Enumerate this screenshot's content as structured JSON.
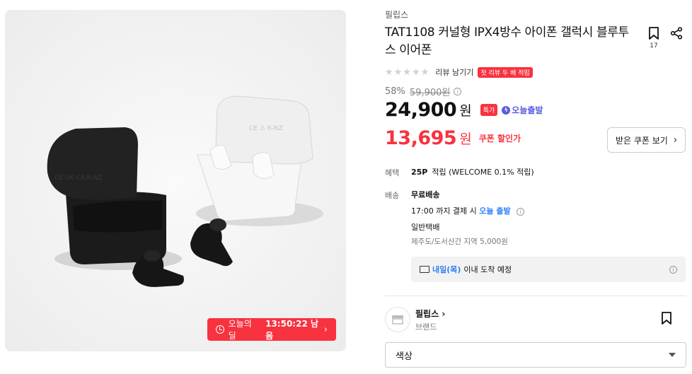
{
  "gallery": {
    "deal_label": "오늘의딜",
    "deal_time": "13:50:22 남음",
    "deal_arrow": "›"
  },
  "product": {
    "brand": "필립스",
    "title": "TAT1108 커널형 IPX4방수 아이폰 갤럭시 블루투스 이어폰",
    "bookmark_count": "17",
    "stars": "★★★★★",
    "review_link": "리뷰 남기기",
    "first_review_badge": "첫 리뷰 두 배 적립",
    "discount_rate": "58%",
    "original_price": "59,900원",
    "price": "24,900",
    "currency": "원",
    "special_badge": "특가",
    "today_delivery": "오늘출발",
    "coupon_price": "13,695",
    "coupon_currency": "원",
    "coupon_label": "쿠폰 할인가",
    "coupon_button": "받은 쿠폰 보기"
  },
  "benefit": {
    "label": "혜택",
    "points": "25P",
    "points_desc": "적립 (WELCOME 0.1% 적립)"
  },
  "shipping": {
    "label": "배송",
    "type": "무료배송",
    "deadline_prefix": "17:00 까지 결제 시",
    "deadline_highlight": "오늘 출발",
    "carrier": "일반택배",
    "extra": "제주도/도서산간 지역 5,000원",
    "arrival_highlight": "내일(목)",
    "arrival_text": "이내 도착 예정"
  },
  "store": {
    "name": "필립스",
    "sub": "브랜드"
  },
  "option": {
    "label": "색상"
  },
  "colors": {
    "accent_red": "#f8323f",
    "blue": "#2d7ff9",
    "purple": "#5b5ce2"
  }
}
